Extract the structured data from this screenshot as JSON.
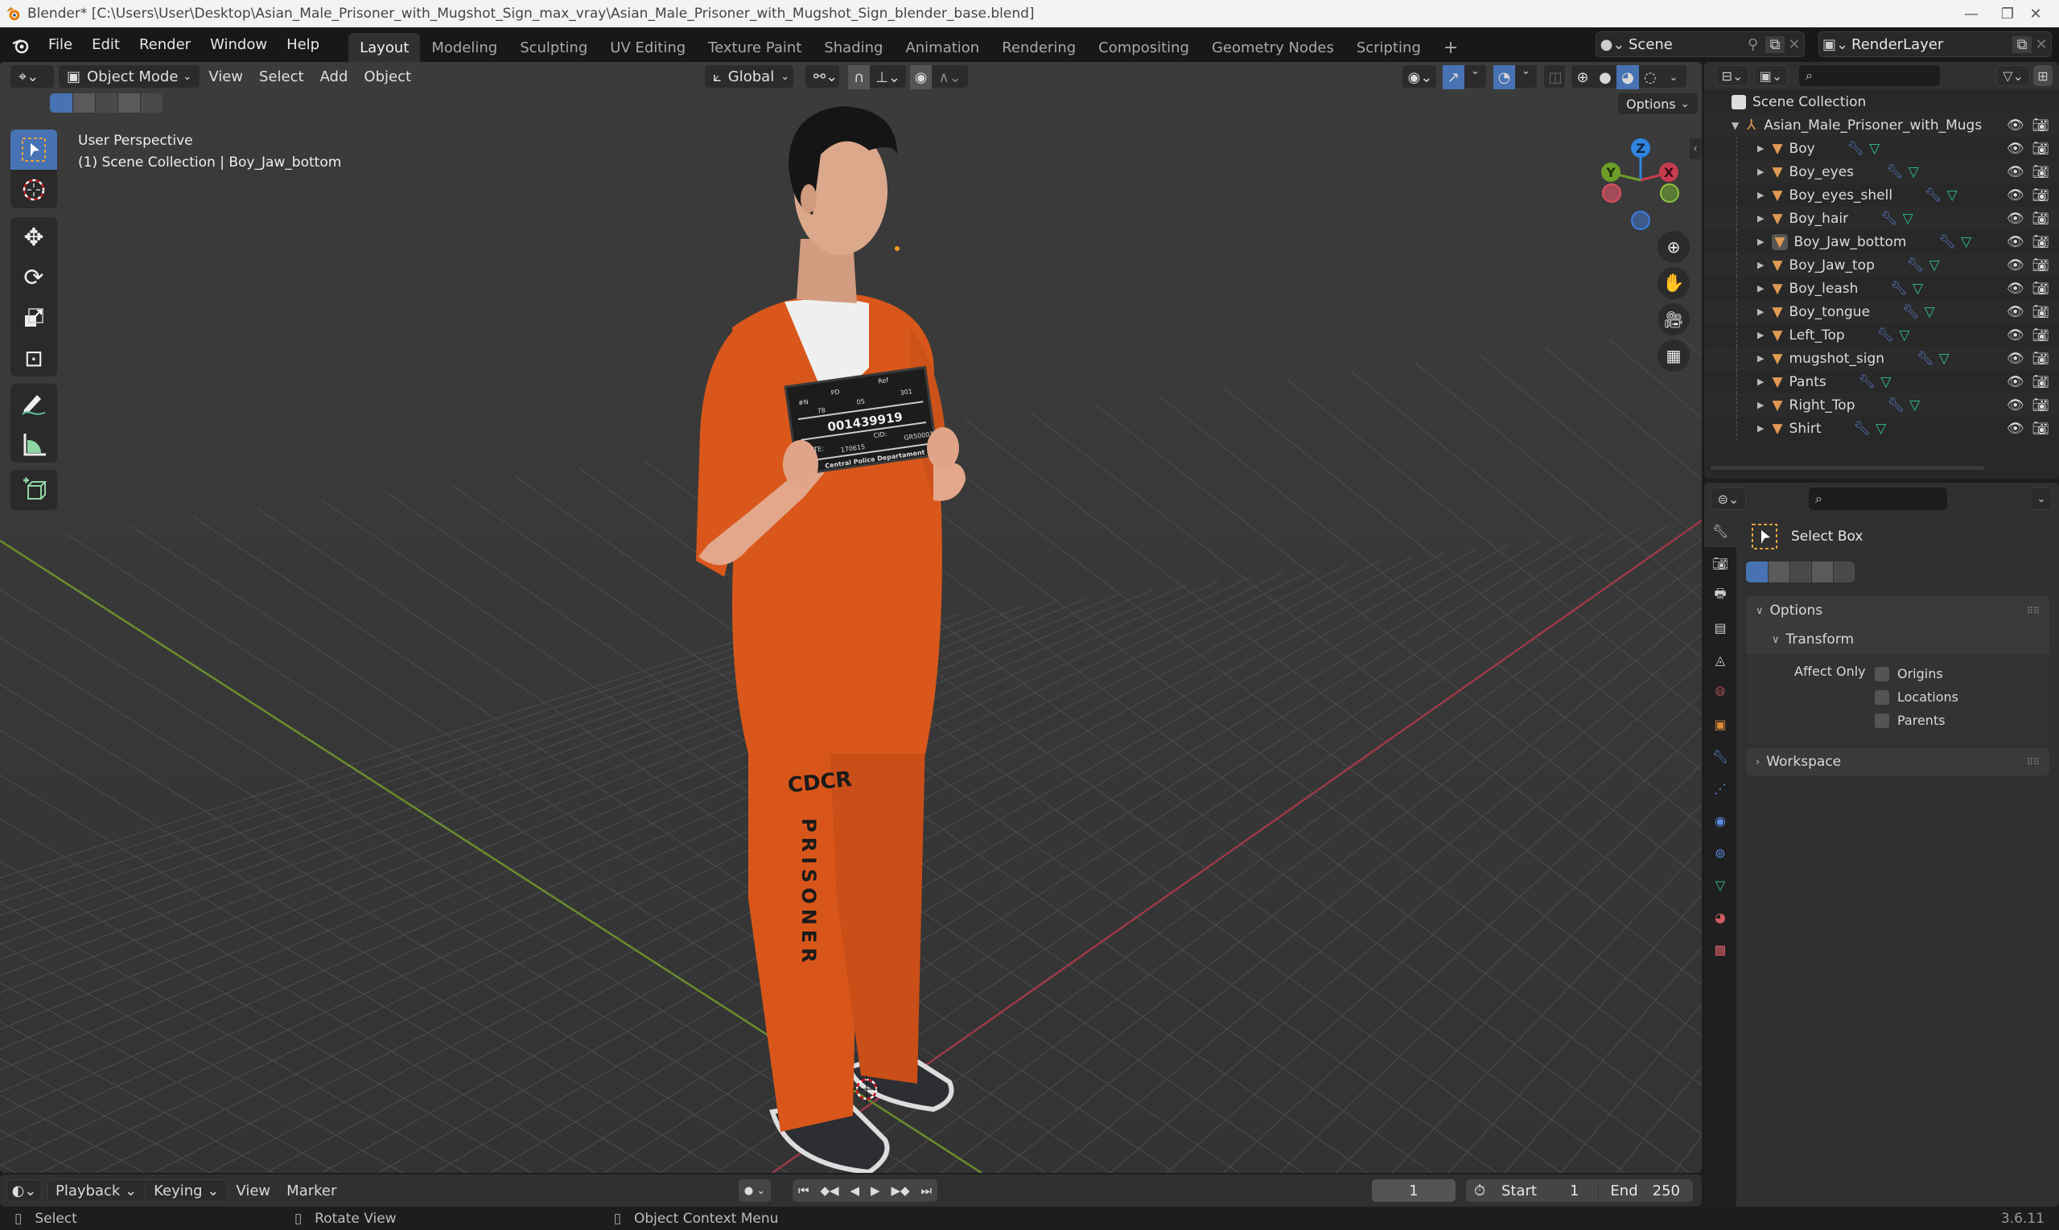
{
  "window": {
    "title": "Blender* [C:\\Users\\User\\Desktop\\Asian_Male_Prisoner_with_Mugshot_Sign_max_vray\\Asian_Male_Prisoner_with_Mugshot_Sign_blender_base.blend]",
    "controls": {
      "minimize": "—",
      "maximize": "❐",
      "close": "✕"
    }
  },
  "topbar": {
    "menus": [
      "File",
      "Edit",
      "Render",
      "Window",
      "Help"
    ],
    "workspaces": [
      "Layout",
      "Modeling",
      "Sculpting",
      "UV Editing",
      "Texture Paint",
      "Shading",
      "Animation",
      "Rendering",
      "Compositing",
      "Geometry Nodes",
      "Scripting"
    ],
    "active_workspace": "Layout",
    "add_workspace": "+",
    "scene": "Scene",
    "view_layer": "RenderLayer"
  },
  "viewport": {
    "mode": "Object Mode",
    "menus": [
      "View",
      "Select",
      "Add",
      "Object"
    ],
    "transform_orientation": "Global",
    "options_label": "Options",
    "overlay_line1": "User Perspective",
    "overlay_line2": "(1) Scene Collection | Boy_Jaw_bottom",
    "gizmo": {
      "z": "Z",
      "y": "Y",
      "x": "X"
    },
    "axis_colors": {
      "x": "#c83c4f",
      "y": "#6e9e2a",
      "z": "#2f85e0"
    },
    "scene_content": {
      "sign_lines": [
        "#N",
        "PD",
        "Ref",
        "78",
        "05",
        "301",
        "001439919",
        "DATE:",
        "170615",
        "CID:",
        "GR50001",
        "Central Police Departament"
      ],
      "pants_text": [
        "CDCR",
        "PRISONER"
      ]
    }
  },
  "tools": [
    "select-box",
    "cursor",
    "move",
    "rotate",
    "scale",
    "transform",
    "annotate",
    "measure",
    "add-cube"
  ],
  "outliner": {
    "search_placeholder": "",
    "root": "Scene Collection",
    "collection": "Asian_Male_Prisoner_with_Mugs",
    "objects": [
      {
        "name": "Boy",
        "selected": false
      },
      {
        "name": "Boy_eyes",
        "selected": false
      },
      {
        "name": "Boy_eyes_shell",
        "selected": false
      },
      {
        "name": "Boy_hair",
        "selected": false
      },
      {
        "name": "Boy_Jaw_bottom",
        "selected": true
      },
      {
        "name": "Boy_Jaw_top",
        "selected": false
      },
      {
        "name": "Boy_leash",
        "selected": false
      },
      {
        "name": "Boy_tongue",
        "selected": false
      },
      {
        "name": "Left_Top",
        "selected": false
      },
      {
        "name": "mugshot_sign",
        "selected": false
      },
      {
        "name": "Pants",
        "selected": false
      },
      {
        "name": "Right_Top",
        "selected": false
      },
      {
        "name": "Shirt",
        "selected": false
      }
    ]
  },
  "properties": {
    "search_placeholder": "",
    "tool_name": "Select Box",
    "options_label": "Options",
    "transform_label": "Transform",
    "affect_only_label": "Affect Only",
    "checkboxes": [
      {
        "label": "Origins",
        "checked": false
      },
      {
        "label": "Locations",
        "checked": false
      },
      {
        "label": "Parents",
        "checked": false
      }
    ],
    "workspace_label": "Workspace",
    "tabs": [
      "tool",
      "render",
      "output",
      "view-layer",
      "scene",
      "world",
      "object",
      "modifiers",
      "particles",
      "physics",
      "constraints",
      "data",
      "material",
      "texture"
    ]
  },
  "timeline": {
    "menus": [
      "Playback",
      "Keying",
      "View",
      "Marker"
    ],
    "current_frame": "1",
    "start_label": "Start",
    "start": "1",
    "end_label": "End",
    "end": "250"
  },
  "statusbar": {
    "left_click": "Select",
    "middle_click": "Rotate View",
    "right_click": "Object Context Menu",
    "version": "3.6.11"
  }
}
